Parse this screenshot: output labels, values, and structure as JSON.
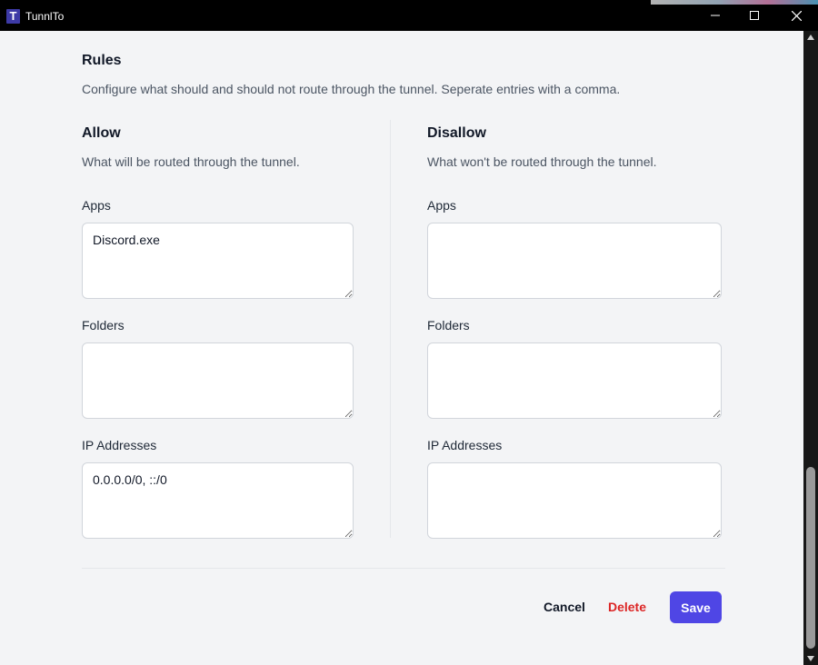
{
  "window": {
    "title": "TunnlTo",
    "icon_letter": "T"
  },
  "rules": {
    "title": "Rules",
    "description": "Configure what should and should not route through the tunnel. Seperate entries with a comma."
  },
  "allow": {
    "title": "Allow",
    "description": "What will be routed through the tunnel.",
    "apps_label": "Apps",
    "apps_value": "Discord.exe",
    "folders_label": "Folders",
    "folders_value": "",
    "ips_label": "IP Addresses",
    "ips_value": "0.0.0.0/0, ::/0"
  },
  "disallow": {
    "title": "Disallow",
    "description": "What won't be routed through the tunnel.",
    "apps_label": "Apps",
    "apps_value": "",
    "folders_label": "Folders",
    "folders_value": "",
    "ips_label": "IP Addresses",
    "ips_value": ""
  },
  "actions": {
    "cancel": "Cancel",
    "delete": "Delete",
    "save": "Save"
  },
  "colors": {
    "primary": "#4f46e5",
    "danger": "#dc2626",
    "background": "#f3f4f6"
  }
}
